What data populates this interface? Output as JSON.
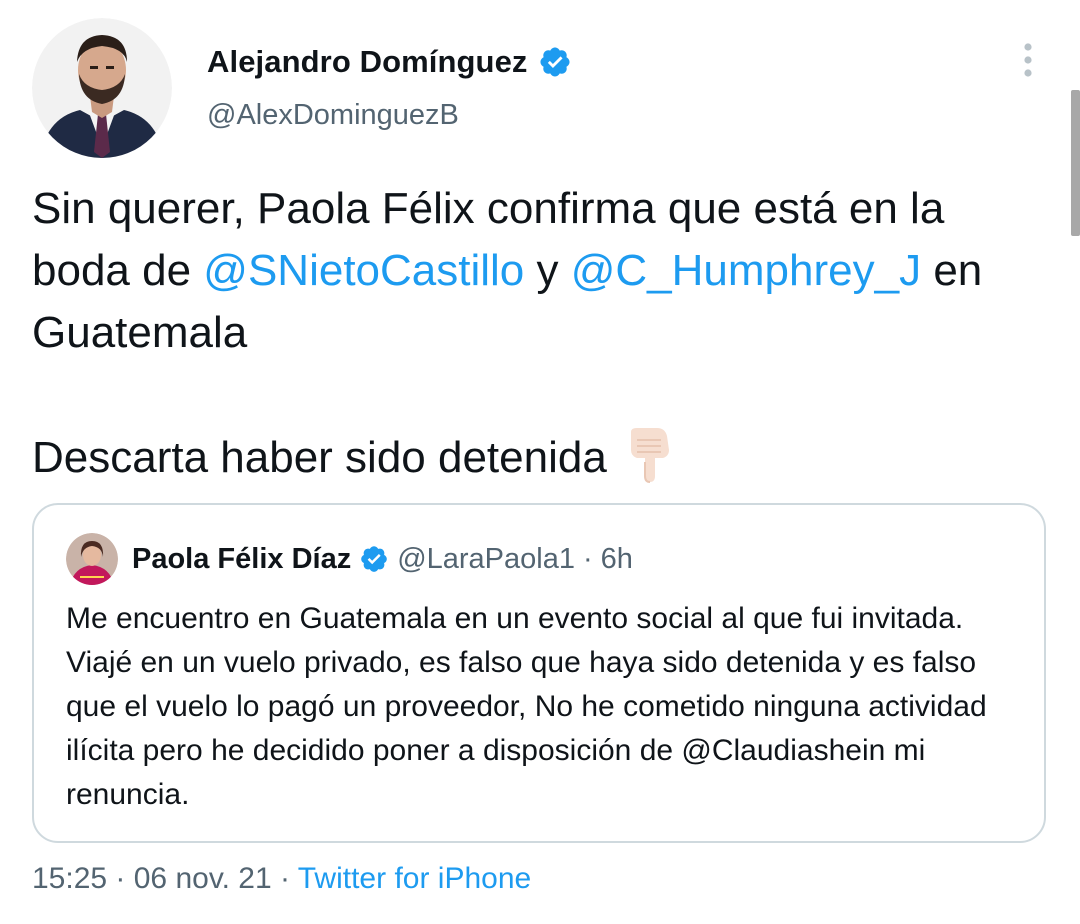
{
  "tweet": {
    "author_name": "Alejandro Domínguez",
    "author_handle": "@AlexDominguezB",
    "verified": true,
    "text": {
      "line1": "Sin querer, Paola Félix confirma que está en la",
      "line2_prefix": "boda de ",
      "mention1": "@SNietoCastillo",
      "line2_mid": " y ",
      "mention2": "@C_Humphrey_J",
      "line2_suffix": " en",
      "line3": "Guatemala",
      "line4": "Descarta haber sido detenida",
      "emoji": "backhand-index-pointing-down-light-skin-tone"
    },
    "timestamp_time": "15:25",
    "separator": " · ",
    "timestamp_date": "06 nov. 21",
    "source": "Twitter for iPhone"
  },
  "quoted_tweet": {
    "author_name": "Paola Félix Díaz",
    "author_handle": "@LaraPaola1",
    "separator": "·",
    "time_ago": "6h",
    "verified": true,
    "text": "Me encuentro en Guatemala en un evento social al que fui invitada. Viajé en un vuelo privado, es falso que haya sido detenida y es falso que el vuelo lo pagó un proveedor, No he cometido ninguna actividad ilícita pero he decidido poner  a disposición de @Claudiashein mi renuncia."
  },
  "colors": {
    "text": "#0f1419",
    "secondary": "#536471",
    "link": "#1d9bf0",
    "verified": "#1d9bf0",
    "border": "#cfd9de"
  },
  "icons": {
    "verified": "verified-badge-icon",
    "more": "more-vertical-icon"
  }
}
